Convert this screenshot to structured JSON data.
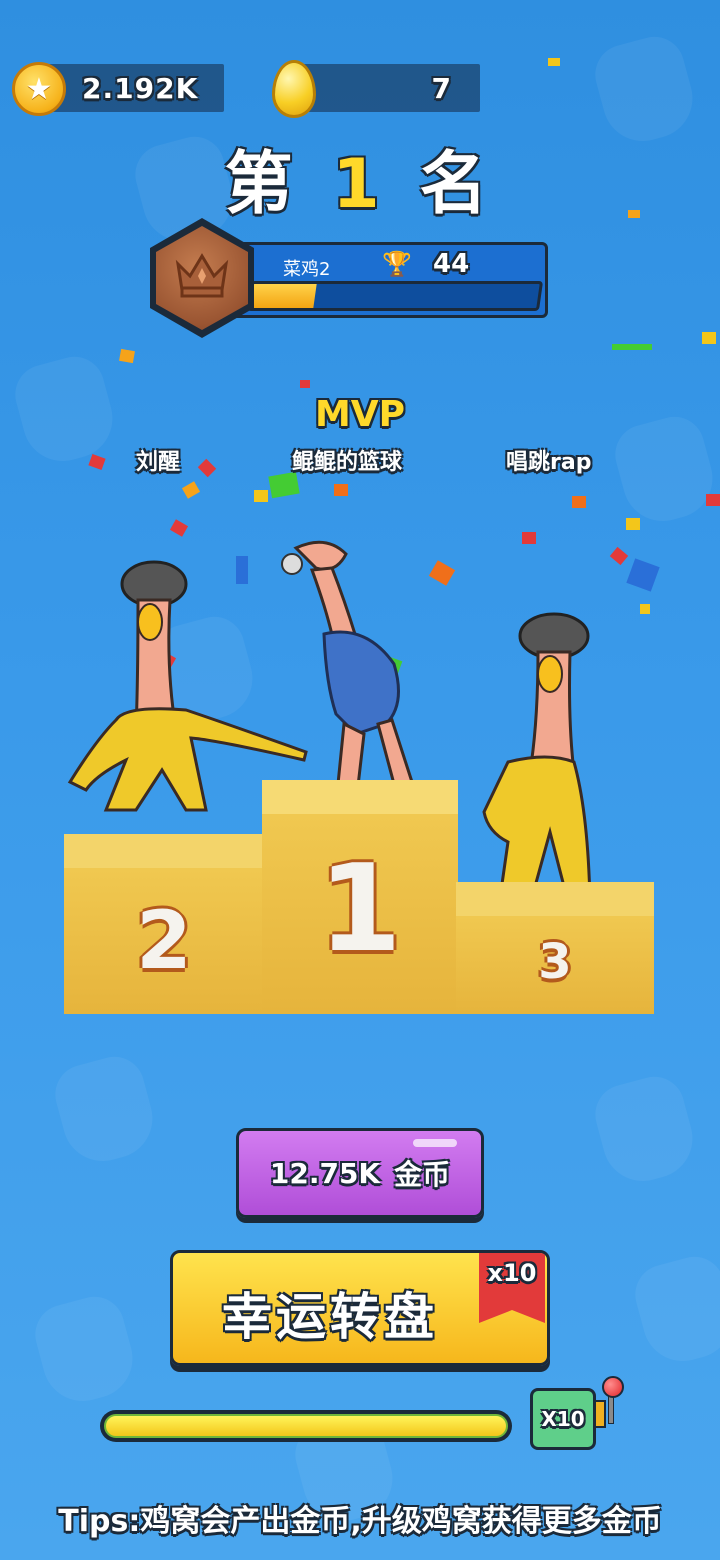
{
  "currency": {
    "gold": "2.192K",
    "eggs": "7"
  },
  "rank_title": {
    "prefix": "第",
    "number": "1",
    "suffix": "名"
  },
  "player": {
    "name": "菜鸡2",
    "trophies": "44",
    "progress_fraction": 0.22
  },
  "mvp_label": "MVP",
  "players": {
    "second": "刘醒",
    "first": "鲲鲲的篮球",
    "third": "唱跳rap"
  },
  "podium": {
    "first": "1",
    "second": "2",
    "third": "3"
  },
  "coin_reward": {
    "amount": "12.75K",
    "unit": "金币"
  },
  "lucky_wheel": {
    "label": "幸运转盘",
    "multiplier": "x10"
  },
  "spin_bar": {
    "multiplier": "X10",
    "progress_fraction": 1.0
  },
  "tips": "Tips:鸡窝会产出金币,升级鸡窝获得更多金币",
  "icons": [
    "star-coin-icon",
    "golden-egg-icon",
    "trophy-icon",
    "crown-badge-icon",
    "slot-lever-icon"
  ],
  "colors": {
    "background": "#3a9aea",
    "accent_yellow": "#ffd92a",
    "purple_button": "#b04ed8",
    "ribbon_red": "#e23a3a"
  }
}
